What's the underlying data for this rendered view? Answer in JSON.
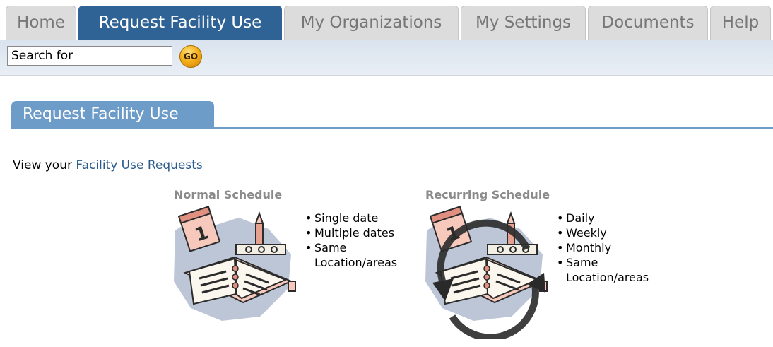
{
  "nav": {
    "tabs": [
      {
        "label": "Home"
      },
      {
        "label": "Request Facility Use"
      },
      {
        "label": "My Organizations"
      },
      {
        "label": "My Settings"
      },
      {
        "label": "Documents"
      },
      {
        "label": "Help"
      }
    ],
    "active_tab": "Request Facility Use"
  },
  "search": {
    "placeholder": "Search for",
    "go_label": "GO"
  },
  "section": {
    "title": "Request Facility Use"
  },
  "view_requests": {
    "prefix": "View your",
    "link": "Facility Use Requests"
  },
  "normal_schedule": {
    "title": "Normal Schedule",
    "items": [
      "Single date",
      "Multiple dates",
      "Same Location/areas"
    ]
  },
  "recurring_schedule": {
    "title": "Recurring Schedule",
    "items": [
      "Daily",
      "Weekly",
      "Monthly",
      "Same Location/areas"
    ]
  },
  "colors": {
    "nav_active": "#2f6396",
    "nav_inactive": "#dcdcdc",
    "section_tab": "#6d9cc9",
    "link": "#2a5b8c"
  }
}
